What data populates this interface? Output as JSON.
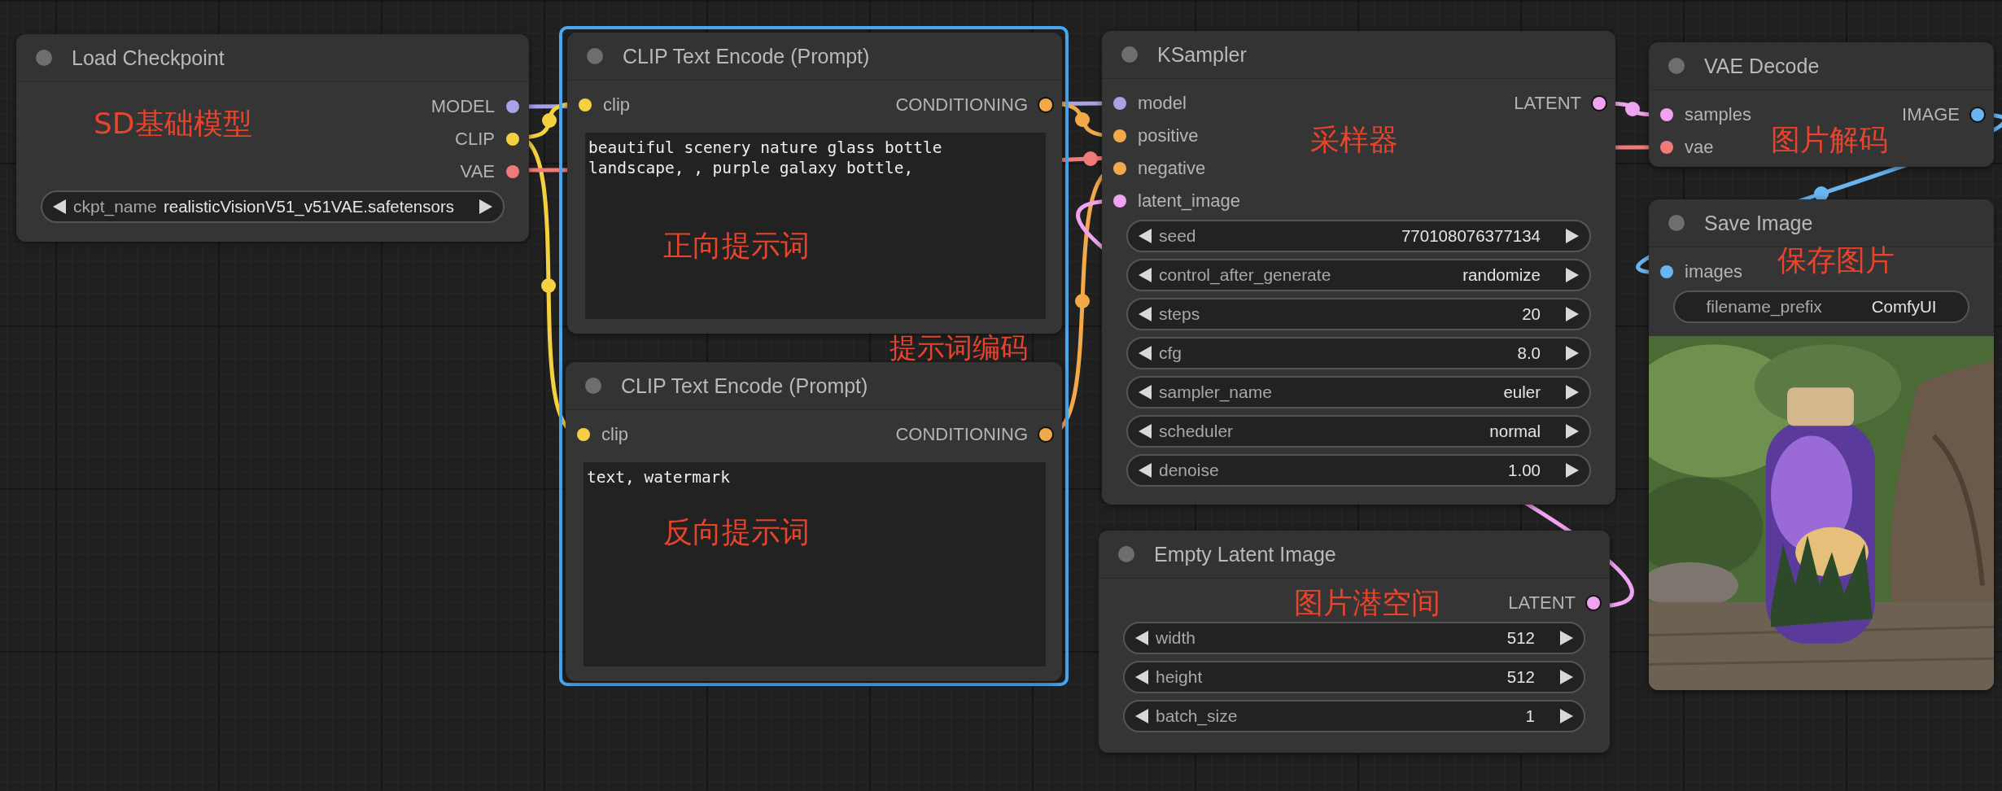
{
  "nodes": [
    {
      "title": "Load Checkpoint",
      "selected": false,
      "outputs": [
        {
          "label": "MODEL",
          "color": "#a8a2e6"
        },
        {
          "label": "CLIP",
          "color": "#f5d142"
        },
        {
          "label": "VAE",
          "color": "#f07a78"
        }
      ],
      "widgets": [
        {
          "kind": "combo",
          "label": "ckpt_name",
          "value": "realisticVisionV51_v51VAE.safetensors"
        }
      ]
    },
    {
      "title": "CLIP Text Encode (Prompt)",
      "selected": true,
      "inputs": [
        {
          "label": "clip",
          "color": "#f5d142"
        }
      ],
      "outputs": [
        {
          "label": "CONDITIONING",
          "color": "#f2a94a"
        }
      ],
      "textarea": "beautiful scenery nature glass bottle landscape, , purple galaxy bottle,"
    },
    {
      "title": "CLIP Text Encode (Prompt)",
      "selected": true,
      "inputs": [
        {
          "label": "clip",
          "color": "#f5d142"
        }
      ],
      "outputs": [
        {
          "label": "CONDITIONING",
          "color": "#f2a94a"
        }
      ],
      "textarea": "text, watermark"
    },
    {
      "title": "KSampler",
      "selected": false,
      "inputs": [
        {
          "label": "model",
          "color": "#a8a2e6"
        },
        {
          "label": "positive",
          "color": "#f2a94a"
        },
        {
          "label": "negative",
          "color": "#f2a94a"
        },
        {
          "label": "latent_image",
          "color": "#f0a3f0"
        }
      ],
      "outputs": [
        {
          "label": "LATENT",
          "color": "#f0a3f0"
        }
      ],
      "widgets": [
        {
          "kind": "number",
          "label": "seed",
          "value": "770108076377134"
        },
        {
          "kind": "combo",
          "label": "control_after_generate",
          "value": "randomize"
        },
        {
          "kind": "number",
          "label": "steps",
          "value": "20"
        },
        {
          "kind": "number",
          "label": "cfg",
          "value": "8.0"
        },
        {
          "kind": "combo",
          "label": "sampler_name",
          "value": "euler"
        },
        {
          "kind": "combo",
          "label": "scheduler",
          "value": "normal"
        },
        {
          "kind": "number",
          "label": "denoise",
          "value": "1.00"
        }
      ]
    },
    {
      "title": "Empty Latent Image",
      "selected": false,
      "outputs": [
        {
          "label": "LATENT",
          "color": "#f0a3f0"
        }
      ],
      "widgets": [
        {
          "kind": "number",
          "label": "width",
          "value": "512"
        },
        {
          "kind": "number",
          "label": "height",
          "value": "512"
        },
        {
          "kind": "number",
          "label": "batch_size",
          "value": "1"
        }
      ]
    },
    {
      "title": "VAE Decode",
      "selected": false,
      "inputs": [
        {
          "label": "samples",
          "color": "#f0a3f0"
        },
        {
          "label": "vae",
          "color": "#f07a78"
        }
      ],
      "outputs": [
        {
          "label": "IMAGE",
          "color": "#6ab4f0"
        }
      ]
    },
    {
      "title": "Save Image",
      "selected": false,
      "inputs": [
        {
          "label": "images",
          "color": "#6ab4f0"
        }
      ],
      "widgets": [
        {
          "kind": "text",
          "label": "filename_prefix",
          "value": "ComfyUI"
        }
      ],
      "preview": {
        "kind": "picture"
      }
    }
  ],
  "annotations": [
    "SD基础模型",
    "正向提示词",
    "提示词编码",
    "反向提示词",
    "采样器",
    "图片解码",
    "保存图片",
    "图片潜空间"
  ]
}
